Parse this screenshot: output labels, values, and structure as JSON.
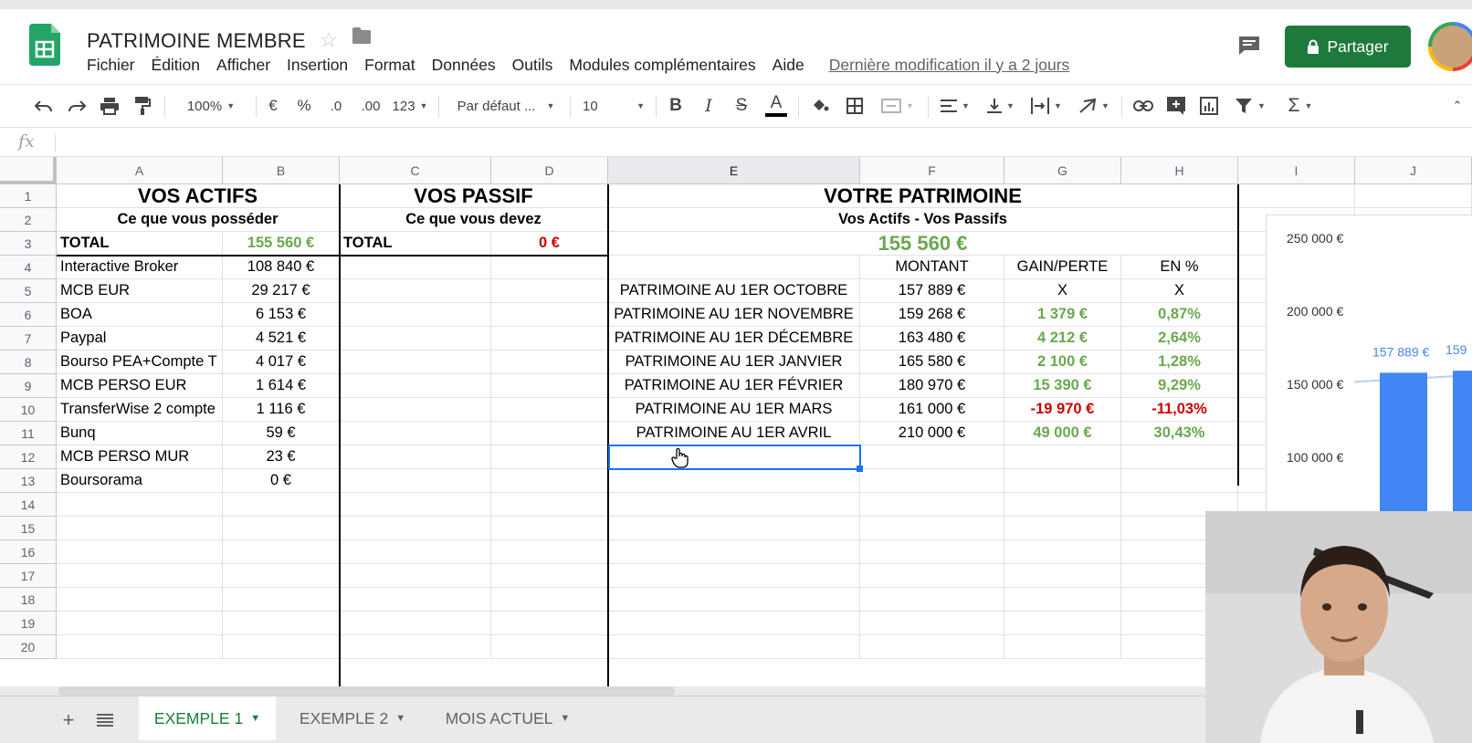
{
  "app": {
    "doc_title": "PATRIMOINE MEMBRE",
    "menus": [
      "Fichier",
      "Édition",
      "Afficher",
      "Insertion",
      "Format",
      "Données",
      "Outils",
      "Modules complémentaires",
      "Aide"
    ],
    "last_edit": "Dernière modification il y a 2 jours",
    "share_label": "Partager",
    "accent": "#1e7a3c"
  },
  "toolbar": {
    "zoom": "100%",
    "currency": "€",
    "percent": "%",
    "dec_less": ".0",
    "dec_more": ".00",
    "format_more": "123",
    "font": "Par défaut ...",
    "font_size": "10",
    "bold": "B",
    "italic": "I",
    "strike": "S",
    "text_color": "A",
    "sum": "Σ"
  },
  "formula_bar": {
    "fx": "fx",
    "value": ""
  },
  "grid": {
    "columns": [
      "A",
      "B",
      "C",
      "D",
      "E",
      "F",
      "G",
      "H",
      "I",
      "J"
    ],
    "rows": [
      "1",
      "2",
      "3",
      "4",
      "5",
      "6",
      "7",
      "8",
      "9",
      "10",
      "11",
      "12",
      "13",
      "14",
      "15",
      "16",
      "17",
      "18",
      "19",
      "20"
    ],
    "actifs": {
      "title": "VOS ACTIFS",
      "subtitle": "Ce que vous posséder",
      "total_label": "TOTAL",
      "total_value": "155 560 €",
      "items": [
        {
          "name": "Interactive Broker",
          "value": "108 840 €"
        },
        {
          "name": "MCB EUR",
          "value": "29 217 €"
        },
        {
          "name": "BOA",
          "value": "6 153 €"
        },
        {
          "name": "Paypal",
          "value": "4 521 €"
        },
        {
          "name": "Bourso PEA+Compte T",
          "value": "4 017 €"
        },
        {
          "name": "MCB PERSO EUR",
          "value": "1 614 €"
        },
        {
          "name": "TransferWise 2 compte",
          "value": "1 116 €"
        },
        {
          "name": "Bunq",
          "value": "59 €"
        },
        {
          "name": "MCB PERSO MUR",
          "value": "23 €"
        },
        {
          "name": "Boursorama",
          "value": "0 €"
        }
      ]
    },
    "passif": {
      "title": "VOS PASSIF",
      "subtitle": "Ce que vous devez",
      "total_label": "TOTAL",
      "total_value": "0 €"
    },
    "patrimoine": {
      "title": "VOTRE PATRIMOINE",
      "subtitle": "Vos Actifs - Vos Passifs",
      "total": "155 560 €",
      "headers": [
        "MONTANT",
        "GAIN/PERTE",
        "EN %"
      ],
      "rows": [
        {
          "label": "PATRIMOINE AU 1ER OCTOBRE",
          "montant": "157 889 €",
          "gain": "X",
          "pct": "X",
          "sign": "none"
        },
        {
          "label": "PATRIMOINE AU 1ER NOVEMBRE",
          "montant": "159 268 €",
          "gain": "1 379 €",
          "pct": "0,87%",
          "sign": "pos"
        },
        {
          "label": "PATRIMOINE AU 1ER DÉCEMBRE",
          "montant": "163 480 €",
          "gain": "4 212 €",
          "pct": "2,64%",
          "sign": "pos"
        },
        {
          "label": "PATRIMOINE AU 1ER JANVIER",
          "montant": "165 580 €",
          "gain": "2 100 €",
          "pct": "1,28%",
          "sign": "pos"
        },
        {
          "label": "PATRIMOINE AU 1ER FÉVRIER",
          "montant": "180 970 €",
          "gain": "15 390 €",
          "pct": "9,29%",
          "sign": "pos"
        },
        {
          "label": "PATRIMOINE AU 1ER MARS",
          "montant": "161 000 €",
          "gain": "-19 970 €",
          "pct": "-11,03%",
          "sign": "neg"
        },
        {
          "label": "PATRIMOINE AU 1ER AVRIL",
          "montant": "210 000 €",
          "gain": "49 000 €",
          "pct": "30,43%",
          "sign": "pos"
        }
      ]
    }
  },
  "chart_data": {
    "type": "bar",
    "y_ticks": [
      "250 000 €",
      "200 000 €",
      "150 000 €",
      "100 000 €"
    ],
    "y_tick_values": [
      250000,
      200000,
      150000,
      100000
    ],
    "visible_values": [
      157889,
      159268
    ],
    "data_labels": [
      "157 889 €",
      "159"
    ],
    "bar_color": "#4285f4",
    "label_color": "#4a86e8"
  },
  "sheet_tabs": [
    {
      "label": "EXEMPLE 1",
      "active": true
    },
    {
      "label": "EXEMPLE 2",
      "active": false
    },
    {
      "label": "MOIS ACTUEL",
      "active": false
    }
  ]
}
